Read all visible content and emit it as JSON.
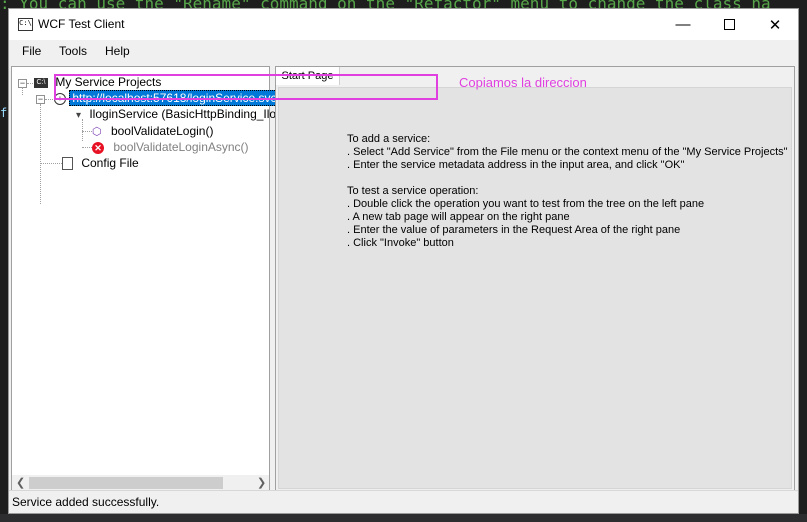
{
  "background": {
    "code_line": ": You can use the \"Rename\" command on the \"Refactor\" menu to change the class na",
    "left_glyph": "f"
  },
  "window": {
    "title": "WCF Test Client",
    "controls": {
      "minimize": "—",
      "maximize": "",
      "close": "✕"
    }
  },
  "menu": {
    "file": "File",
    "tools": "Tools",
    "help": "Help"
  },
  "tree": {
    "root": "My Service Projects",
    "endpoint": "http://localhost:57618/loginService.svc",
    "contract": "IloginService (BasicHttpBinding_Ilogin",
    "op1": "boolValidateLogin()",
    "op2": "boolValidateLoginAsync()",
    "config": "Config File"
  },
  "tabs": {
    "start": "Start Page"
  },
  "instructions": {
    "add_heading": "To add a service:",
    "add_1": ". Select \"Add Service\" from the File menu or the context menu of the \"My Service Projects\"",
    "add_2": ". Enter the service metadata address in the input area, and click \"OK\"",
    "test_heading": "To test a service operation:",
    "test_1": ". Double click the operation you want to test from the tree on the left pane",
    "test_2": ". A new tab page will appear on the right pane",
    "test_3": ". Enter the value of parameters in the Request Area of the right pane",
    "test_4": ". Click \"Invoke\" button"
  },
  "annotation": {
    "text": "Copiamos la direccion",
    "color": "#e040e0"
  },
  "status": {
    "text": "Service added successfully."
  },
  "colors": {
    "selection": "#0078d7",
    "error": "#e81123",
    "op_icon": "#7a3fb5"
  }
}
